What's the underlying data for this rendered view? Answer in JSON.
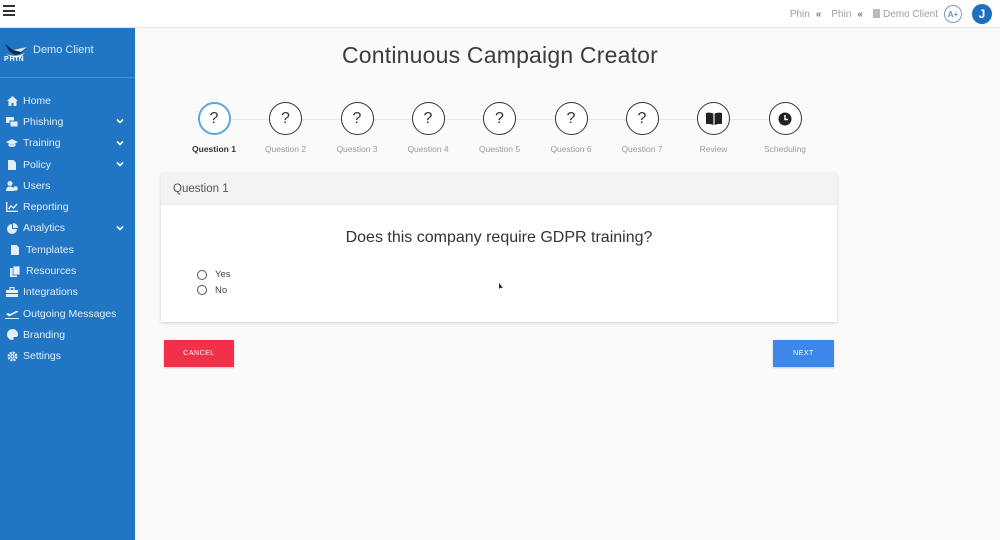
{
  "topbar": {
    "menu_icon": "hamburger-icon",
    "breadcrumbs": [
      {
        "label": "Phin",
        "icon": "double-chevron-left-icon"
      },
      {
        "label": "Phin",
        "icon": "double-chevron-left-icon"
      }
    ],
    "client": {
      "label": "Demo Client",
      "icon": "building-icon"
    },
    "accessibility_badge": "A+",
    "avatar_initial": "J"
  },
  "sidebar": {
    "brand_logo_text": "PHIN",
    "client_name": "Demo Client",
    "items": [
      {
        "label": "Home",
        "icon": "home-icon",
        "expandable": false
      },
      {
        "label": "Phishing",
        "icon": "phishing-icon",
        "expandable": true
      },
      {
        "label": "Training",
        "icon": "graduation-cap-icon",
        "expandable": true
      },
      {
        "label": "Policy",
        "icon": "document-icon",
        "expandable": true
      },
      {
        "label": "Users",
        "icon": "users-icon",
        "expandable": false
      },
      {
        "label": "Reporting",
        "icon": "line-chart-icon",
        "expandable": false
      },
      {
        "label": "Analytics",
        "icon": "pie-chart-icon",
        "expandable": true
      },
      {
        "label": "Templates",
        "icon": "file-template-icon",
        "expandable": false
      },
      {
        "label": "Resources",
        "icon": "copy-icon",
        "expandable": false
      },
      {
        "label": "Integrations",
        "icon": "toolbox-icon",
        "expandable": false
      },
      {
        "label": "Outgoing Messages",
        "icon": "plane-departure-icon",
        "expandable": false
      },
      {
        "label": "Branding",
        "icon": "palette-icon",
        "expandable": false
      },
      {
        "label": "Settings",
        "icon": "gear-icon",
        "expandable": false
      }
    ]
  },
  "main": {
    "title": "Continuous Campaign Creator",
    "steps": [
      {
        "label": "Question 1",
        "glyph": "?",
        "icon": "question-icon",
        "active": true
      },
      {
        "label": "Question 2",
        "glyph": "?",
        "icon": "question-icon",
        "active": false
      },
      {
        "label": "Question 3",
        "glyph": "?",
        "icon": "question-icon",
        "active": false
      },
      {
        "label": "Question 4",
        "glyph": "?",
        "icon": "question-icon",
        "active": false
      },
      {
        "label": "Question 5",
        "glyph": "?",
        "icon": "question-icon",
        "active": false
      },
      {
        "label": "Question 6",
        "glyph": "?",
        "icon": "question-icon",
        "active": false
      },
      {
        "label": "Question 7",
        "glyph": "?",
        "icon": "question-icon",
        "active": false
      },
      {
        "label": "Review",
        "glyph": "",
        "icon": "book-open-icon",
        "active": false
      },
      {
        "label": "Scheduling",
        "glyph": "",
        "icon": "clock-icon",
        "active": false
      }
    ],
    "card": {
      "header": "Question 1",
      "question": "Does this company require GDPR training?",
      "options": [
        {
          "label": "Yes",
          "selected": false
        },
        {
          "label": "No",
          "selected": false
        }
      ]
    },
    "buttons": {
      "cancel": "CANCEL",
      "next": "NEXT"
    }
  },
  "colors": {
    "sidebar": "#2075c4",
    "active_step": "#5ba7de",
    "cancel": "#f2304a",
    "next": "#3d86ea",
    "avatar": "#1f6fbf"
  }
}
